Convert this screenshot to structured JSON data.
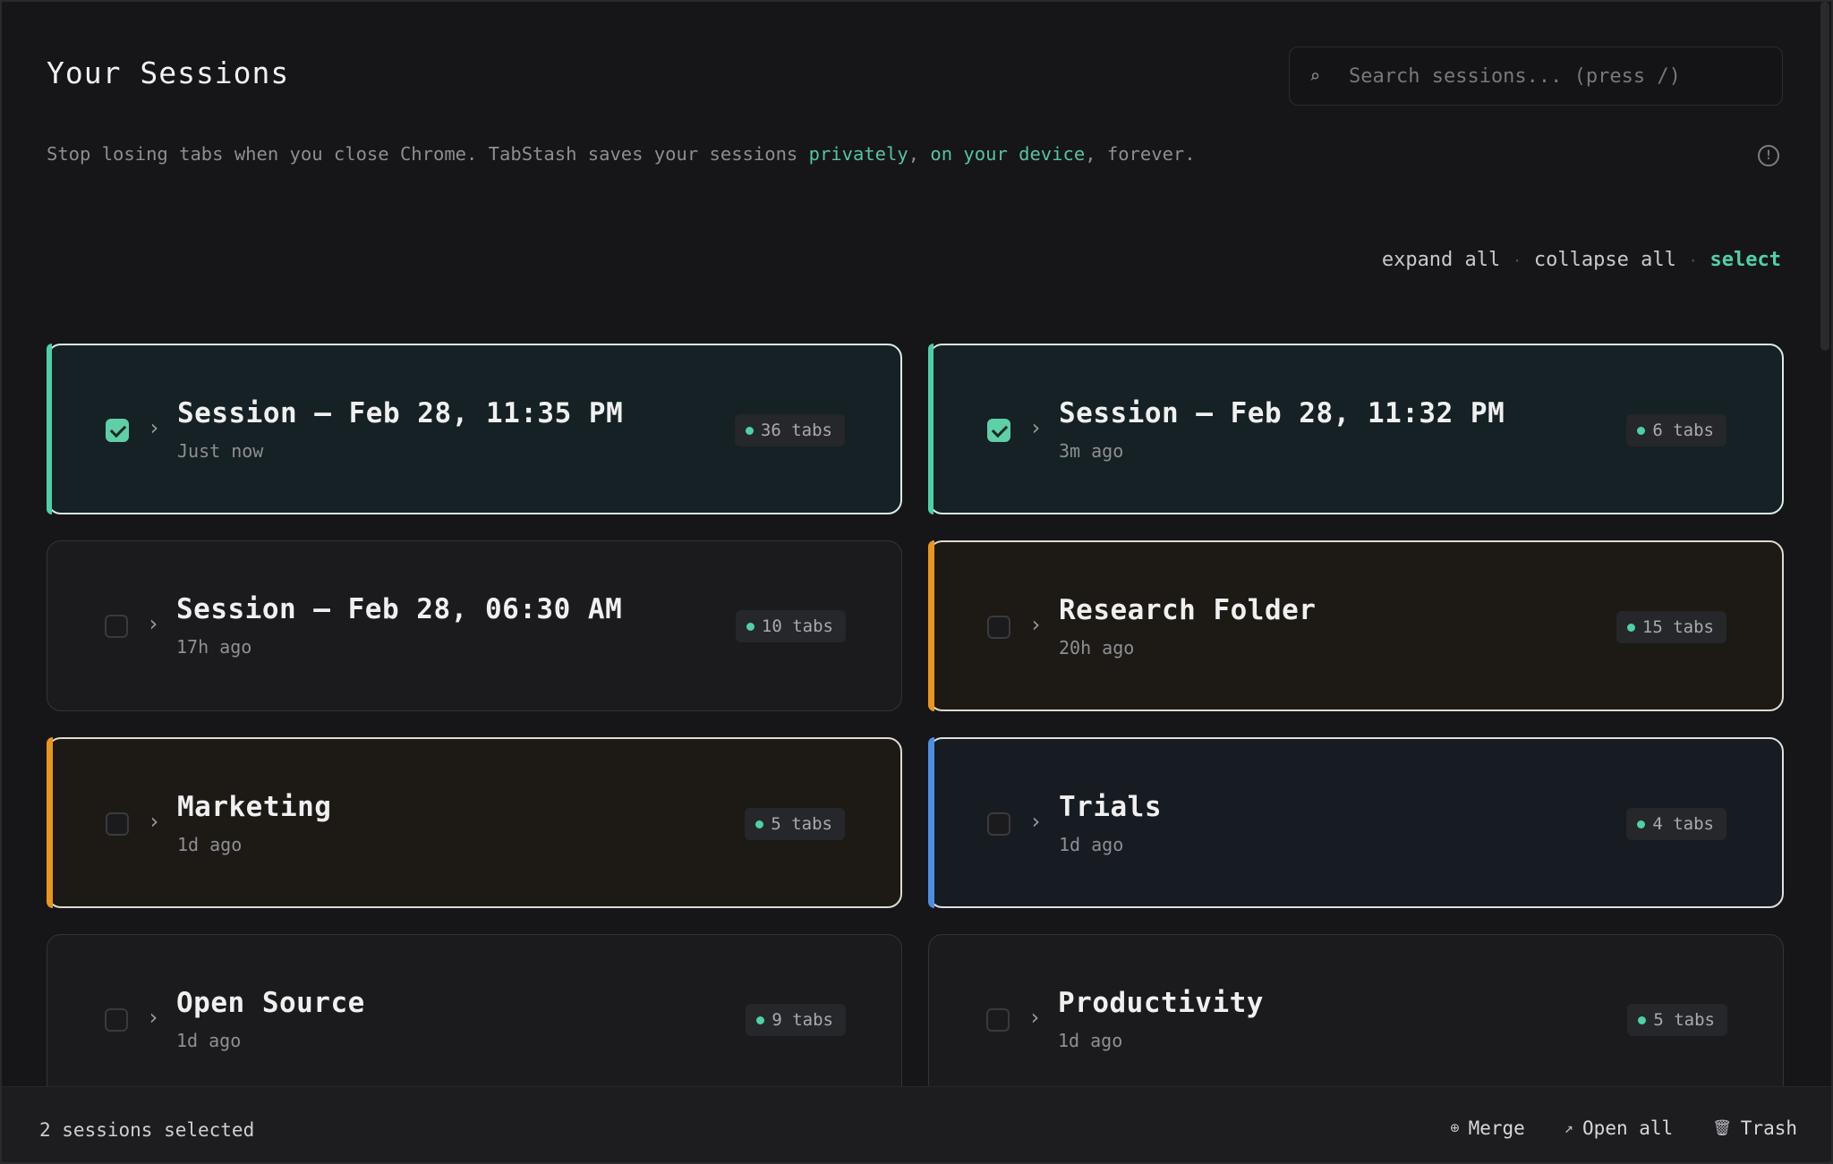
{
  "header": {
    "title": "Your Sessions",
    "search_placeholder": "Search sessions... (press /)",
    "search_icon": "search-icon",
    "subtitle_parts": [
      "Stop losing tabs when you close Chrome. TabStash saves your sessions ",
      "privately",
      ", ",
      "on your device",
      ", forever."
    ]
  },
  "view_controls": {
    "expand_all": "expand all",
    "collapse_all": "collapse all",
    "select": "select",
    "separator": "·"
  },
  "sessions": [
    {
      "title": "Session — Feb 28, 11:35 PM",
      "time": "Just now",
      "tabs": "36 tabs",
      "selected": true,
      "accent": "#4fcfa5"
    },
    {
      "title": "Session — Feb 28, 11:32 PM",
      "time": "3m ago",
      "tabs": "6 tabs",
      "selected": true,
      "accent": "#4fcfa5"
    },
    {
      "title": "Session — Feb 28, 06:30 AM",
      "time": "17h ago",
      "tabs": "10 tabs",
      "selected": false,
      "accent": null
    },
    {
      "title": "Research Folder",
      "time": "20h ago",
      "tabs": "15 tabs",
      "selected": false,
      "accent": "#e8961f"
    },
    {
      "title": "Marketing",
      "time": "1d ago",
      "tabs": "5 tabs",
      "selected": false,
      "accent": "#e8961f"
    },
    {
      "title": "Trials",
      "time": "1d ago",
      "tabs": "4 tabs",
      "selected": false,
      "accent": "#4c8fe0"
    },
    {
      "title": "Open Source",
      "time": "1d ago",
      "tabs": "9 tabs",
      "selected": false,
      "accent": null
    },
    {
      "title": "Productivity",
      "time": "1d ago",
      "tabs": "5 tabs",
      "selected": false,
      "accent": null
    }
  ],
  "bottom_bar": {
    "selected_count": "2 sessions selected",
    "merge": "Merge",
    "open_all": "Open all",
    "trash": "Trash"
  },
  "colors": {
    "brand_accent": "#4fd1a5",
    "background": "#161618"
  }
}
